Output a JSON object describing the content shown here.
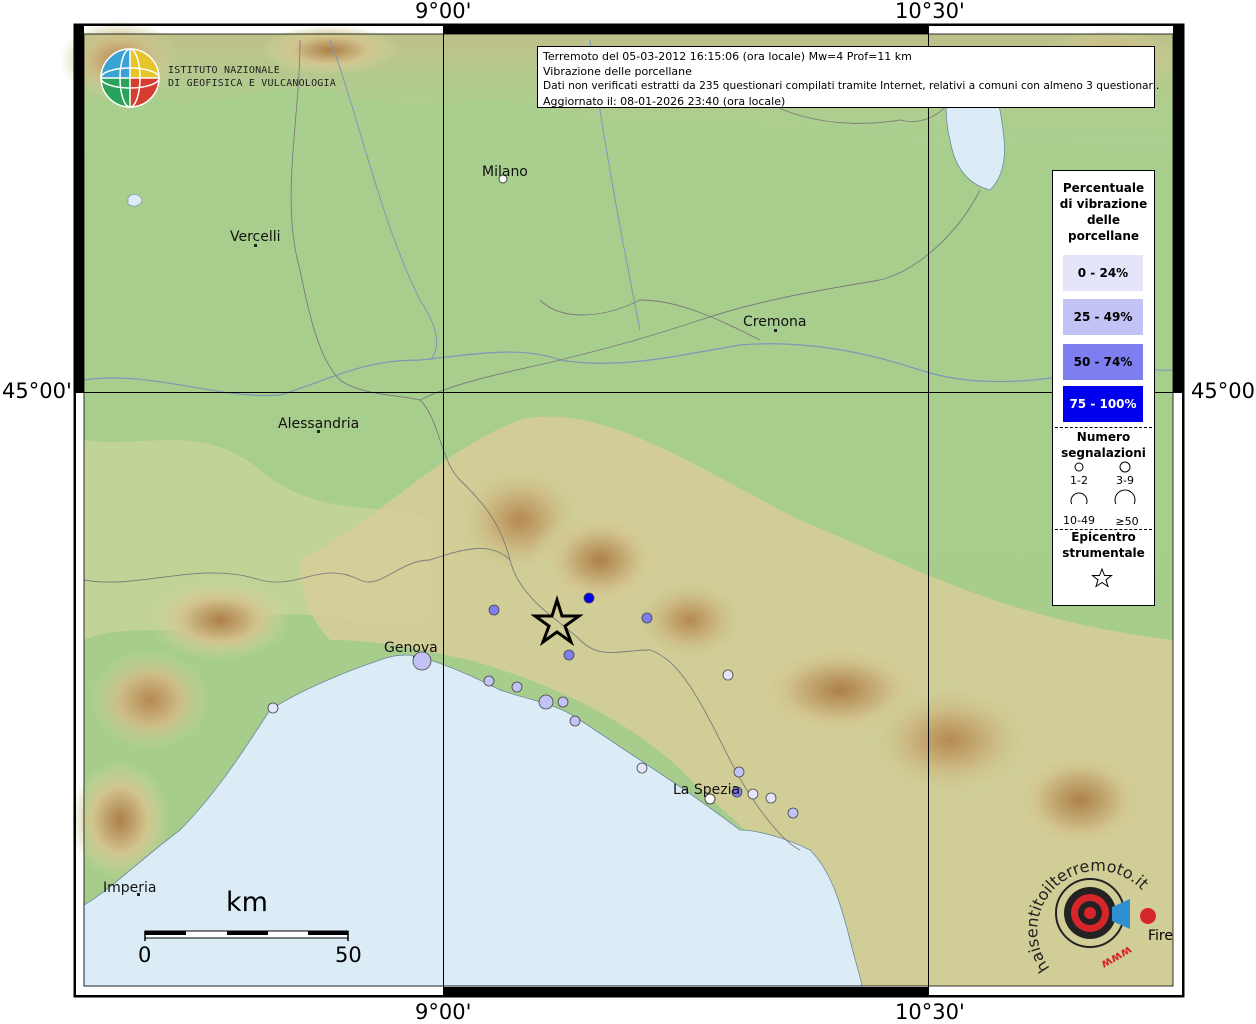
{
  "axis": {
    "top_labels": [
      "9°00'",
      "10°30'"
    ],
    "bottom_labels": [
      "9°00'",
      "10°30'"
    ],
    "left_label": "45°00'",
    "right_label": "45°00'"
  },
  "logo": {
    "line1": "ISTITUTO NAZIONALE",
    "line2": "DI GEOFISICA E VULCANOLOGIA"
  },
  "info": {
    "line1": "Terremoto del 05-03-2012 16:15:06 (ora locale) Mw=4 Prof=11 km",
    "line2": "Vibrazione delle porcellane",
    "line3": "Dati non verificati estratti da 235 questionari compilati tramite Internet, relativi a comuni con almeno 3 questionari.",
    "line4": "Aggiornato il: 08-01-2026 23:40 (ora locale)"
  },
  "legend": {
    "title": [
      "Percentuale",
      "di vibrazione",
      "delle",
      "porcellane"
    ],
    "classes": [
      {
        "label": "0 - 24%",
        "color": "#e4e4fb",
        "text_color": "#000000"
      },
      {
        "label": "25 - 49%",
        "color": "#c2c2f5",
        "text_color": "#000000"
      },
      {
        "label": "50 - 74%",
        "color": "#7e7ef0",
        "text_color": "#000000"
      },
      {
        "label": "75 - 100%",
        "color": "#0000ee",
        "text_color": "#ffffff"
      }
    ],
    "count_title": [
      "Numero",
      "segnalazioni"
    ],
    "count_classes": [
      "1-2",
      "3-9",
      "10-49",
      "≥50"
    ],
    "epicenter_title": [
      "Epicentro",
      "strumentale"
    ]
  },
  "cities": [
    {
      "name": "Milano"
    },
    {
      "name": "Vercelli"
    },
    {
      "name": "Cremona"
    },
    {
      "name": "Alessandria"
    },
    {
      "name": "Genova"
    },
    {
      "name": "La Spezia"
    },
    {
      "name": "Imperia"
    }
  ],
  "scale": {
    "unit": "km",
    "min": "0",
    "max": "50"
  },
  "brand": {
    "arc_text": "haisentitoilterremoto.it",
    "www": "www",
    "fire": "Fire"
  },
  "colors": {
    "sea": "#dcecf7",
    "lowland": "#a8cc8e",
    "hills": "#d8cf9a",
    "mountains": "#a3743f"
  }
}
